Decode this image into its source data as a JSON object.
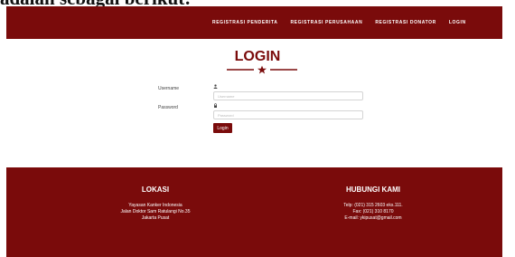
{
  "page_caption": "adalah sebagai berikut:",
  "navbar": {
    "links": [
      "REGISTRASI PENDERITA",
      "REGISTRASI PERUSAHAAN",
      "REGISTRASI DONATOR",
      "LOGIN"
    ]
  },
  "login": {
    "title": "LOGIN",
    "username_label": "Username",
    "username_placeholder": "Username",
    "password_label": "Password",
    "password_placeholder": "Password",
    "button_label": "Login"
  },
  "footer": {
    "location": {
      "heading": "LOKASI",
      "lines": [
        "Yayasan Kanker Indonesia",
        "Jalan Doktor Sam Ratulangi No.35",
        "Jakarta Pusat"
      ]
    },
    "contact": {
      "heading": "HUBUNGI KAMI",
      "lines": [
        "Telp: (021) 315 2603 eks.111.",
        "Fax: (021) 310 8170",
        "E-mail: ykipusat@gmail.com"
      ]
    }
  },
  "colors": {
    "brand": "#7a0b0b",
    "text_light": "#ffffff"
  }
}
